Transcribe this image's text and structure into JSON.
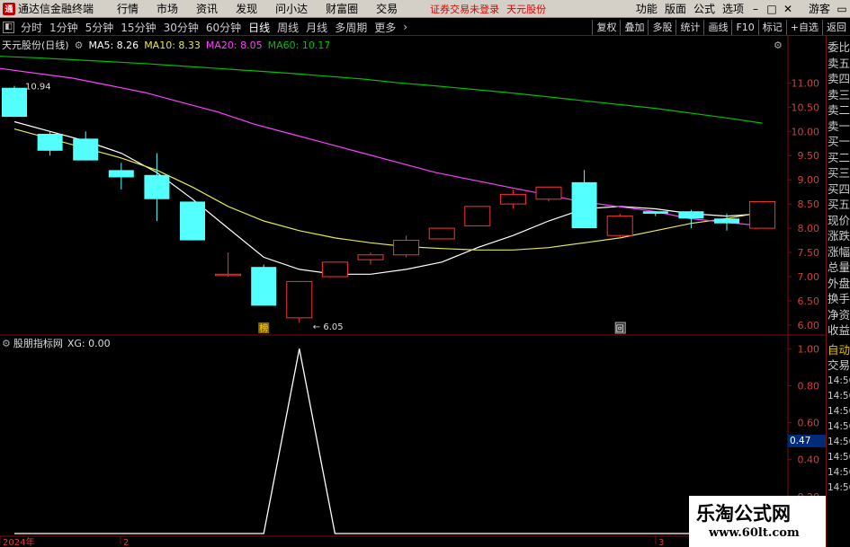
{
  "titlebar": {
    "app_title": "通达信金融终端",
    "menus": [
      "行情",
      "市场",
      "资讯",
      "发现",
      "问小达",
      "财富圈",
      "交易"
    ],
    "notice": "证券交易未登录",
    "stock": "天元股份",
    "right_menus": [
      "功能",
      "版面",
      "公式",
      "选项"
    ],
    "guest": "游客",
    "win_min": "–",
    "win_max": "□",
    "win_close": "✕",
    "win_restore": "▭"
  },
  "periodbar": {
    "periods": [
      "分时",
      "1分钟",
      "5分钟",
      "15分钟",
      "30分钟",
      "60分钟",
      "日线",
      "周线",
      "月线",
      "多周期",
      "更多"
    ],
    "active": "日线",
    "more_arrow": "›",
    "tools": [
      "复权",
      "叠加",
      "多股",
      "统计",
      "画线",
      "F10",
      "标记",
      "+自选",
      "返回"
    ]
  },
  "main_chart": {
    "title": "天元股份(日线)",
    "ma5_label": "MA5: 8.26",
    "ma10_label": "MA10: 8.33",
    "ma20_label": "MA20: 8.05",
    "ma60_label": "MA60: 10.17",
    "high_label": "10.94",
    "low_label": "6.05",
    "marker_bang": "榜",
    "marker_hui": "回"
  },
  "sub_chart": {
    "title": "股朋指标网",
    "value_label": "XG: 0.00",
    "current_value": "0.47"
  },
  "x_axis": {
    "labels": [
      "2024年",
      "2",
      "3"
    ]
  },
  "side_panel": {
    "items": [
      "委比",
      "卖五",
      "卖四",
      "卖三",
      "卖二",
      "卖一",
      "买一",
      "买二",
      "买三",
      "买四",
      "买五",
      "现价",
      "涨跌",
      "涨幅",
      "总量",
      "外盘",
      "换手",
      "净资",
      "收益"
    ],
    "auto_label": "自动",
    "trade_label": "交易",
    "times": [
      "14:56",
      "14:56",
      "14:56",
      "14:56",
      "14:56",
      "14:56",
      "14:56",
      "14:56"
    ]
  },
  "watermark": {
    "title": "乐淘公式网",
    "url": "www.60lt.com"
  },
  "colors": {
    "up": "#ff3232",
    "down": "#54ffff",
    "ma5": "#ffffff",
    "ma10": "#e8e84a",
    "ma20": "#ff40ff",
    "ma60": "#00c000",
    "axis_red": "#7a1010"
  },
  "chart_data": {
    "type": "candlestick",
    "price_axis": {
      "ticks": [
        "11.00",
        "10.50",
        "10.00",
        "9.50",
        "9.00",
        "8.50",
        "8.00",
        "7.50",
        "7.00",
        "6.50",
        "6.00"
      ],
      "range": [
        5.85,
        11.6
      ]
    },
    "sub_axis": {
      "ticks": [
        "1.00",
        "0.80",
        "0.60",
        "0.40",
        "0.20",
        "0.00"
      ],
      "range": [
        0,
        1.05
      ]
    },
    "candles": [
      {
        "o": 10.9,
        "h": 10.94,
        "c": 10.3,
        "l": 10.3
      },
      {
        "o": 9.95,
        "h": 10.0,
        "c": 9.6,
        "l": 9.5
      },
      {
        "o": 9.85,
        "h": 10.0,
        "c": 9.4,
        "l": 9.4
      },
      {
        "o": 9.2,
        "h": 9.35,
        "c": 9.05,
        "l": 8.8
      },
      {
        "o": 9.1,
        "h": 9.55,
        "c": 8.6,
        "l": 8.15
      },
      {
        "o": 8.55,
        "h": 8.55,
        "c": 7.75,
        "l": 7.75
      },
      {
        "o": 7.05,
        "h": 7.5,
        "c": 7.05,
        "l": 7.0
      },
      {
        "o": 7.2,
        "h": 7.25,
        "c": 6.4,
        "l": 6.4
      },
      {
        "o": 6.15,
        "h": 6.9,
        "c": 6.9,
        "l": 6.05
      },
      {
        "o": 7.0,
        "h": 7.3,
        "c": 7.3,
        "l": 7.0
      },
      {
        "o": 7.35,
        "h": 7.5,
        "c": 7.45,
        "l": 7.25
      },
      {
        "o": 7.45,
        "h": 7.85,
        "c": 7.75,
        "l": 7.4
      },
      {
        "o": 7.78,
        "h": 8.0,
        "c": 8.0,
        "l": 7.78
      },
      {
        "o": 8.05,
        "h": 8.45,
        "c": 8.45,
        "l": 8.05
      },
      {
        "o": 8.5,
        "h": 8.8,
        "c": 8.7,
        "l": 8.4
      },
      {
        "o": 8.6,
        "h": 8.85,
        "c": 8.85,
        "l": 8.55
      },
      {
        "o": 8.95,
        "h": 9.2,
        "c": 8.0,
        "l": 8.0
      },
      {
        "o": 7.85,
        "h": 8.3,
        "c": 8.25,
        "l": 7.8
      },
      {
        "o": 8.35,
        "h": 8.35,
        "c": 8.3,
        "l": 8.25
      },
      {
        "o": 8.35,
        "h": 8.38,
        "c": 8.2,
        "l": 8.0
      },
      {
        "o": 8.2,
        "h": 8.3,
        "c": 8.1,
        "l": 7.95
      },
      {
        "o": 8.0,
        "h": 8.55,
        "c": 8.55,
        "l": 8.0
      }
    ],
    "series": [
      {
        "name": "MA5",
        "values": [
          10.2,
          10.0,
          9.8,
          9.55,
          9.15,
          8.6,
          8.0,
          7.4,
          7.15,
          7.05,
          7.05,
          7.15,
          7.3,
          7.6,
          7.85,
          8.15,
          8.4,
          8.45,
          8.4,
          8.3,
          8.25,
          8.3
        ]
      },
      {
        "name": "MA10",
        "values": [
          10.05,
          9.85,
          9.65,
          9.45,
          9.2,
          8.85,
          8.45,
          8.15,
          7.95,
          7.8,
          7.7,
          7.62,
          7.58,
          7.55,
          7.55,
          7.6,
          7.7,
          7.8,
          7.95,
          8.1,
          8.2,
          8.33
        ]
      },
      {
        "name": "MA20",
        "values": [
          11.3,
          11.2,
          11.1,
          10.95,
          10.8,
          10.6,
          10.4,
          10.15,
          9.95,
          9.75,
          9.55,
          9.35,
          9.15,
          9.0,
          8.85,
          8.7,
          8.55,
          8.45,
          8.35,
          8.2,
          8.12,
          8.05
        ]
      },
      {
        "name": "MA60",
        "values": [
          11.55,
          11.52,
          11.48,
          11.44,
          11.4,
          11.35,
          11.3,
          11.25,
          11.2,
          11.14,
          11.08,
          11.0,
          10.94,
          10.87,
          10.8,
          10.72,
          10.64,
          10.56,
          10.48,
          10.38,
          10.28,
          10.17
        ]
      }
    ],
    "xg": [
      0,
      0,
      0,
      0,
      0,
      0,
      0,
      0,
      1,
      0,
      0,
      0,
      0,
      0,
      0,
      0,
      0,
      0,
      0,
      0,
      0,
      0
    ]
  }
}
